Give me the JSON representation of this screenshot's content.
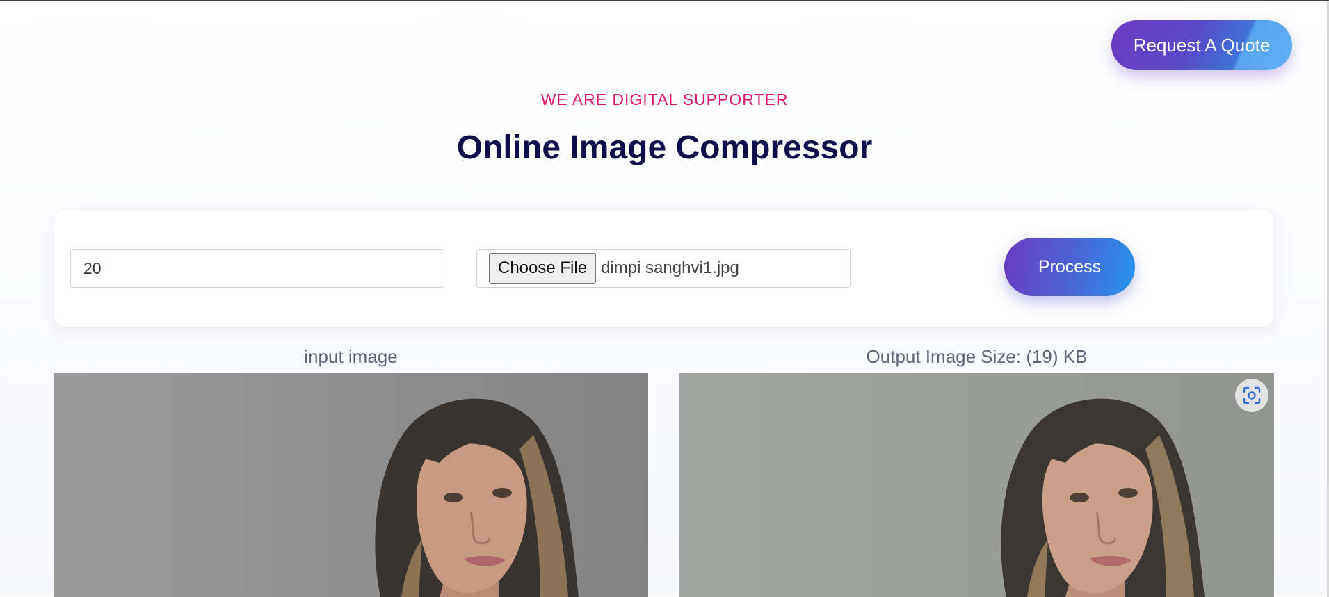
{
  "header": {
    "quote_button": "Request A Quote",
    "eyebrow": "WE ARE DIGITAL SUPPORTER",
    "title": "Online Image Compressor"
  },
  "form": {
    "quality_value": "20",
    "choose_file_label": "Choose File",
    "file_name": "dimpi sanghvi1.jpg",
    "process_label": "Process"
  },
  "preview": {
    "input_label": "input image",
    "output_label": "Output Image Size: (19) KB"
  },
  "colors": {
    "accent_pink": "#e2136e",
    "title_navy": "#0e0e4a",
    "gradient_purple": "#6a3bc0",
    "gradient_blue": "#2695ee"
  },
  "icons": {
    "lens": "visual-search-icon"
  }
}
